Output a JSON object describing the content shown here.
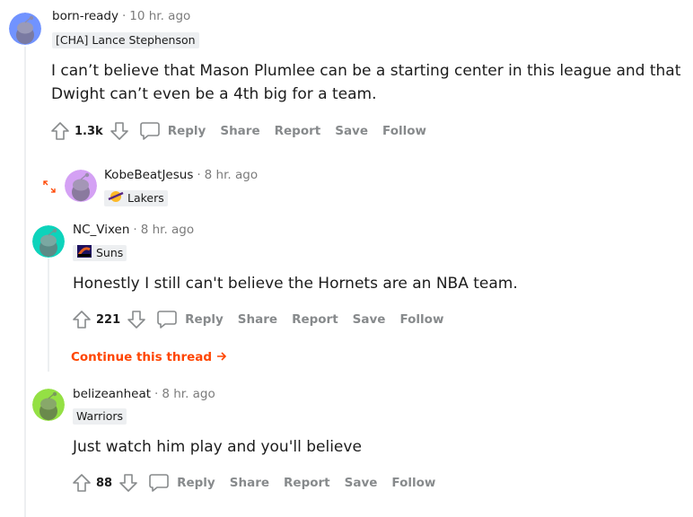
{
  "comments": [
    {
      "username": "born-ready",
      "separator": "·",
      "time": "10 hr. ago",
      "flair": "[CHA] Lance Stephenson",
      "body_lines": [
        "I can’t believe that Mason Plumlee can be a starting center in this league and that",
        "Dwight can’t even be a 4th big for a team."
      ],
      "score": "1.3k",
      "avatar_color": "#7193ff"
    },
    {
      "username": "KobeBeatJesus",
      "separator": "·",
      "time": "8 hr. ago",
      "flair": "Lakers",
      "avatar_color": "#d4a1f4",
      "collapsed": true
    },
    {
      "username": "NC_Vixen",
      "separator": "·",
      "time": "8 hr. ago",
      "flair": "Suns",
      "body": "Honestly I still can't believe the Hornets are an NBA team.",
      "score": "221",
      "avatar_color": "#0dd3bb"
    },
    {
      "username": "belizeanheat",
      "separator": "·",
      "time": "8 hr. ago",
      "flair": "Warriors",
      "body": "Just watch him play and you'll believe",
      "score": "88",
      "avatar_color": "#94e044"
    }
  ],
  "actions": {
    "reply": "Reply",
    "share": "Share",
    "report": "Report",
    "save": "Save",
    "follow": "Follow"
  },
  "continue_thread": "Continue this thread",
  "colors": {
    "accent": "#ff4500",
    "muted": "#878a8c",
    "thread_line": "#edeff1"
  }
}
